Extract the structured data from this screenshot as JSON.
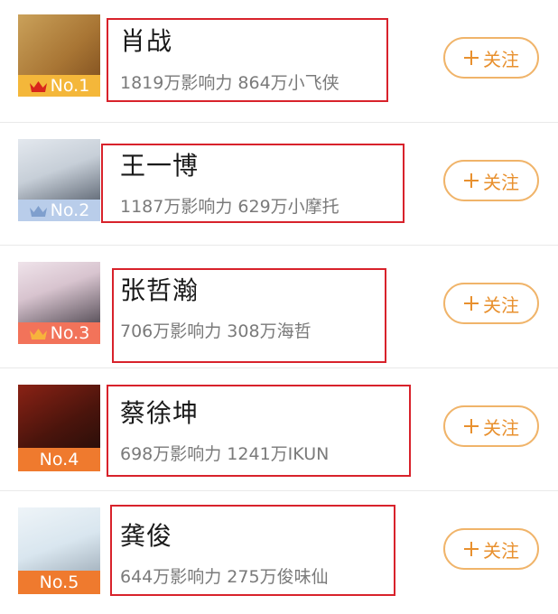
{
  "list": {
    "follow_label": "关注",
    "items": [
      {
        "rank_label": "No.1",
        "name": "肖战",
        "stats": "1819万影响力 864万小飞侠",
        "badge_color": "#f4b73a",
        "crown_color": "#d9261c",
        "photo_colors": [
          "#caa15a",
          "#7a4a1c"
        ]
      },
      {
        "rank_label": "No.2",
        "name": "王一博",
        "stats": "1187万影响力 629万小摩托",
        "badge_color": "#b9cdea",
        "crown_color": "#7f9fcd",
        "photo_colors": [
          "#c7cfd8",
          "#3b4452"
        ]
      },
      {
        "rank_label": "No.3",
        "name": "张哲瀚",
        "stats": "706万影响力 308万海哲",
        "badge_color": "#f2735a",
        "crown_color": "#f7b33c",
        "photo_colors": [
          "#d8c4cf",
          "#2b2730"
        ]
      },
      {
        "rank_label": "No.4",
        "name": "蔡徐坤",
        "stats": "698万影响力 1241万IKUN",
        "badge_color": "#ef7a2e",
        "crown_color": "",
        "photo_colors": [
          "#8a2215",
          "#1c0c08"
        ]
      },
      {
        "rank_label": "No.5",
        "name": "龚俊",
        "stats": "644万影响力 275万俊味仙",
        "badge_color": "#ef7a2e",
        "crown_color": "",
        "photo_colors": [
          "#d9e6ef",
          "#8d9ba8"
        ]
      }
    ]
  }
}
